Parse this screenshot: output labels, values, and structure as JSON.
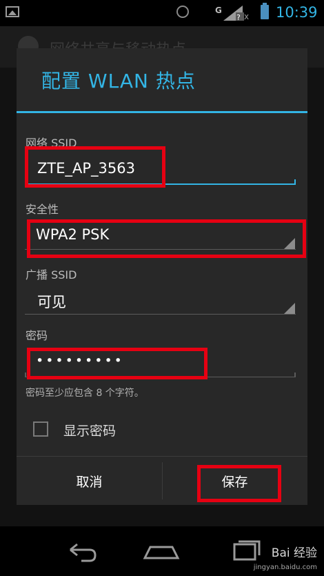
{
  "status_bar": {
    "time": "10:39",
    "signal_type": "G",
    "icons": [
      "image-icon",
      "alarm-icon",
      "signal-icon",
      "battery-icon"
    ]
  },
  "background": {
    "title": "网络共享与移动热点"
  },
  "dialog": {
    "title": "配置 WLAN 热点",
    "ssid_label": "网络 SSID",
    "ssid_value": "ZTE_AP_3563",
    "security_label": "安全性",
    "security_value": "WPA2 PSK",
    "broadcast_label": "广播 SSID",
    "broadcast_value": "可见",
    "password_label": "密码",
    "password_value": "•••••••••",
    "password_hint": "密码至少应包含 8 个字符。",
    "show_password_label": "显示密码",
    "show_password_checked": false,
    "cancel_label": "取消",
    "save_label": "保存"
  },
  "watermark": {
    "brand": "Bai 经验",
    "url": "jingyan.baidu.com"
  },
  "colors": {
    "accent": "#33b5e5",
    "highlight": "#e60012",
    "dialog_bg": "#282828"
  }
}
